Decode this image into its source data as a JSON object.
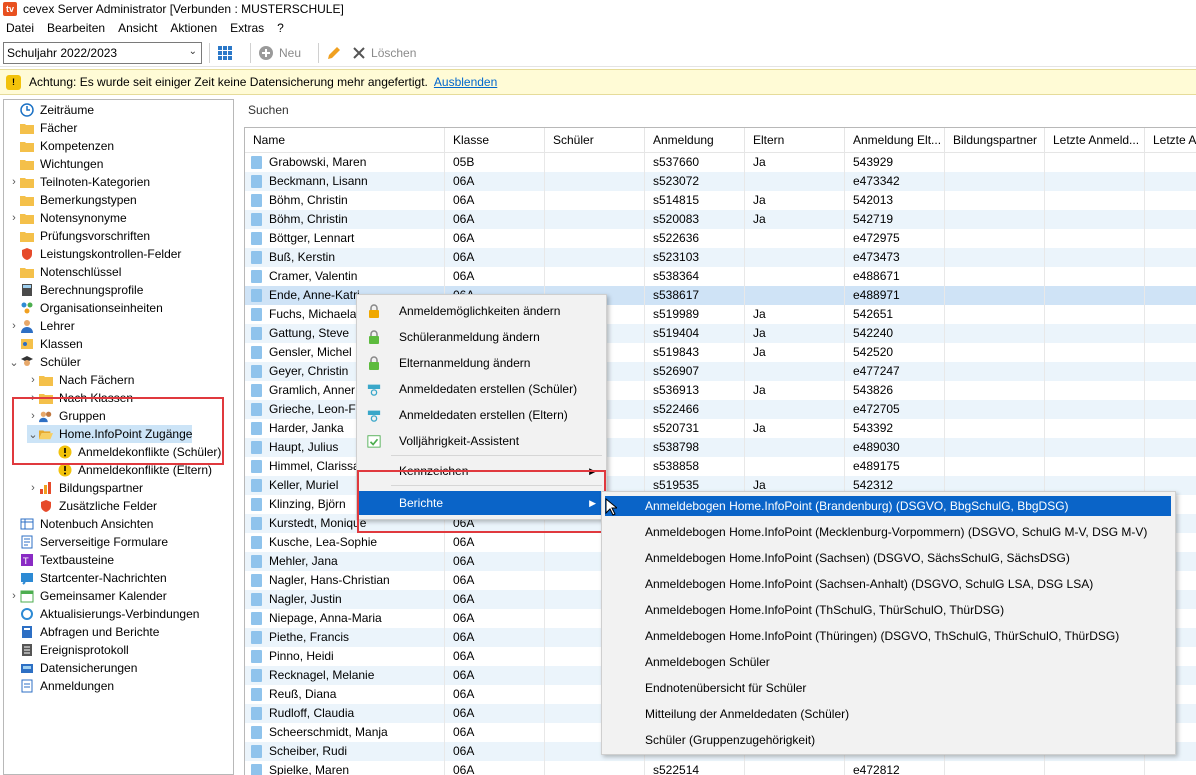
{
  "window": {
    "title": "cevex Server Administrator [Verbunden : MUSTERSCHULE]",
    "logo": "tv"
  },
  "menu": [
    "Datei",
    "Bearbeiten",
    "Ansicht",
    "Aktionen",
    "Extras",
    "?"
  ],
  "toolbar": {
    "school_year": "Schuljahr 2022/2023",
    "new_label": "Neu",
    "delete_label": "Löschen"
  },
  "warning": {
    "text": "Achtung: Es wurde seit einiger Zeit keine Datensicherung mehr angefertigt.",
    "link": "Ausblenden",
    "icon": "warning-icon"
  },
  "tree": [
    {
      "label": "Zeiträume",
      "icon": "clock-icon",
      "level": 0
    },
    {
      "label": "Fächer",
      "icon": "folder-icon",
      "level": 0
    },
    {
      "label": "Kompetenzen",
      "icon": "folder-icon",
      "level": 0
    },
    {
      "label": "Wichtungen",
      "icon": "folder-icon",
      "level": 0
    },
    {
      "label": "Teilnoten-Kategorien",
      "icon": "folder-icon",
      "level": 0,
      "exp": "›"
    },
    {
      "label": "Bemerkungstypen",
      "icon": "folder-icon",
      "level": 0
    },
    {
      "label": "Notensynonyme",
      "icon": "folder-icon",
      "level": 0,
      "exp": "›"
    },
    {
      "label": "Prüfungsvorschriften",
      "icon": "folder-icon",
      "level": 0
    },
    {
      "label": "Leistungskontrollen-Felder",
      "icon": "shield-icon",
      "level": 0
    },
    {
      "label": "Notenschlüssel",
      "icon": "folder-icon",
      "level": 0
    },
    {
      "label": "Berechnungsprofile",
      "icon": "calculator-icon",
      "level": 0
    },
    {
      "label": "Organisationseinheiten",
      "icon": "org-icon",
      "level": 0
    },
    {
      "label": "Lehrer",
      "icon": "person-icon",
      "level": 0,
      "exp": "›"
    },
    {
      "label": "Klassen",
      "icon": "class-icon",
      "level": 0
    },
    {
      "label": "Schüler",
      "icon": "student-icon",
      "level": 0,
      "exp": "⌄"
    },
    {
      "label": "Nach Fächern",
      "icon": "folder-icon",
      "level": 1,
      "exp": "›"
    },
    {
      "label": "Nach Klassen",
      "icon": "folder-icon",
      "level": 1,
      "exp": "›"
    },
    {
      "label": "Gruppen",
      "icon": "group-icon",
      "level": 1,
      "exp": "›"
    },
    {
      "label": "Home.InfoPoint Zugänge",
      "icon": "folder-open-icon",
      "level": 1,
      "exp": "⌄"
    },
    {
      "label": "Anmeldekonflikte (Schüler)",
      "icon": "warning-icon",
      "level": 2
    },
    {
      "label": "Anmeldekonflikte (Eltern)",
      "icon": "warning-icon",
      "level": 2
    },
    {
      "label": "Bildungspartner",
      "icon": "chart-icon",
      "level": 1,
      "exp": "›"
    },
    {
      "label": "Zusätzliche Felder",
      "icon": "shield-icon",
      "level": 1
    },
    {
      "label": "Notenbuch Ansichten",
      "icon": "table-icon",
      "level": 0
    },
    {
      "label": "Serverseitige Formulare",
      "icon": "form-icon",
      "level": 0
    },
    {
      "label": "Textbausteine",
      "icon": "text-icon",
      "level": 0
    },
    {
      "label": "Startcenter-Nachrichten",
      "icon": "message-icon",
      "level": 0
    },
    {
      "label": "Gemeinsamer Kalender",
      "icon": "calendar-icon",
      "level": 0,
      "exp": "›"
    },
    {
      "label": "Aktualisierungs-Verbindungen",
      "icon": "sync-icon",
      "level": 0
    },
    {
      "label": "Abfragen und Berichte",
      "icon": "report-icon",
      "level": 0
    },
    {
      "label": "Ereignisprotokoll",
      "icon": "log-icon",
      "level": 0
    },
    {
      "label": "Datensicherungen",
      "icon": "backup-icon",
      "level": 0
    },
    {
      "label": "Anmeldungen",
      "icon": "login-icon",
      "level": 0
    }
  ],
  "search_label": "Suchen",
  "columns": [
    "Name",
    "Klasse",
    "Schüler",
    "Anmeldung",
    "Eltern",
    "Anmeldung Elt...",
    "Bildungspartner",
    "Letzte Anmeld...",
    "Letzte A"
  ],
  "rows": [
    [
      "Grabowski, Maren",
      "05B",
      "",
      "s537660",
      "Ja",
      "543929"
    ],
    [
      "Beckmann, Lisann",
      "06A",
      "",
      "s523072",
      "",
      "e473342"
    ],
    [
      "Böhm, Christin",
      "06A",
      "",
      "s514815",
      "Ja",
      "542013"
    ],
    [
      "Böhm, Christin",
      "06A",
      "",
      "s520083",
      "Ja",
      "542719"
    ],
    [
      "Böttger, Lennart",
      "06A",
      "",
      "s522636",
      "",
      "e472975"
    ],
    [
      "Buß, Kerstin",
      "06A",
      "",
      "s523103",
      "",
      "e473473"
    ],
    [
      "Cramer, Valentin",
      "06A",
      "",
      "s538364",
      "",
      "e488671"
    ],
    [
      "Ende, Anne-Katri",
      "06A",
      "",
      "s538617",
      "",
      "e488971"
    ],
    [
      "Fuchs, Michaela",
      "",
      "",
      "s519989",
      "Ja",
      "542651"
    ],
    [
      "Gattung, Steve",
      "",
      "",
      "s519404",
      "Ja",
      "542240"
    ],
    [
      "Gensler, Michel",
      "",
      "",
      "s519843",
      "Ja",
      "542520"
    ],
    [
      "Geyer, Christin",
      "",
      "",
      "s526907",
      "",
      "e477247"
    ],
    [
      "Gramlich, Anner",
      "",
      "",
      "s536913",
      "Ja",
      "543826"
    ],
    [
      "Grieche, Leon-Fa",
      "",
      "",
      "s522466",
      "",
      "e472705"
    ],
    [
      "Harder, Janka",
      "",
      "",
      "s520731",
      "Ja",
      "543392"
    ],
    [
      "Haupt, Julius",
      "",
      "",
      "s538798",
      "",
      "e489030"
    ],
    [
      "Himmel, Clarissa",
      "",
      "",
      "s538858",
      "",
      "e489175"
    ],
    [
      "Keller, Muriel",
      "",
      "",
      "s519535",
      "Ja",
      "542312"
    ],
    [
      "Klinzing, Björn",
      "",
      "",
      "",
      "",
      ""
    ],
    [
      "Kurstedt, Monique",
      "06A",
      "",
      "",
      "",
      ""
    ],
    [
      "Kusche, Lea-Sophie",
      "06A",
      "",
      "",
      "",
      ""
    ],
    [
      "Mehler, Jana",
      "06A",
      "",
      "",
      "",
      ""
    ],
    [
      "Nagler, Hans-Christian",
      "06A",
      "",
      "",
      "",
      ""
    ],
    [
      "Nagler, Justin",
      "06A",
      "",
      "",
      "",
      ""
    ],
    [
      "Niepage, Anna-Maria",
      "06A",
      "",
      "",
      "",
      ""
    ],
    [
      "Piethe, Francis",
      "06A",
      "",
      "",
      "",
      ""
    ],
    [
      "Pinno, Heidi",
      "06A",
      "",
      "",
      "",
      ""
    ],
    [
      "Recknagel, Melanie",
      "06A",
      "",
      "",
      "",
      ""
    ],
    [
      "Reuß, Diana",
      "06A",
      "",
      "",
      "",
      ""
    ],
    [
      "Rudloff, Claudia",
      "06A",
      "",
      "",
      "",
      ""
    ],
    [
      "Scheerschmidt, Manja",
      "06A",
      "",
      "",
      "",
      ""
    ],
    [
      "Scheiber, Rudi",
      "06A",
      "",
      "",
      "",
      ""
    ],
    [
      "Spielke, Maren",
      "06A",
      "",
      "s522514",
      "",
      "e472812"
    ]
  ],
  "context_menu": [
    {
      "label": "Anmeldemöglichkeiten ändern",
      "icon": "lock-orange-icon"
    },
    {
      "label": "Schüleranmeldung ändern",
      "icon": "lock-green-icon"
    },
    {
      "label": "Elternanmeldung ändern",
      "icon": "lock-green-icon"
    },
    {
      "label": "Anmeldedaten erstellen (Schüler)",
      "icon": "credentials-icon"
    },
    {
      "label": "Anmeldedaten erstellen (Eltern)",
      "icon": "credentials-icon"
    },
    {
      "label": "Volljährigkeit-Assistent",
      "icon": "wizard-icon"
    },
    {
      "label": "Kennzeichen",
      "icon": "",
      "submenu": true
    },
    {
      "label": "Berichte",
      "icon": "",
      "submenu": true,
      "highlight": true
    }
  ],
  "reports_submenu": [
    "Anmeldebogen Home.InfoPoint (Brandenburg) (DSGVO, BbgSchulG, BbgDSG)",
    "Anmeldebogen Home.InfoPoint (Mecklenburg-Vorpommern) (DSGVO, SchulG M-V, DSG M-V)",
    "Anmeldebogen Home.InfoPoint (Sachsen) (DSGVO, SächsSchulG, SächsDSG)",
    "Anmeldebogen Home.InfoPoint (Sachsen-Anhalt) (DSGVO, SchulG LSA, DSG LSA)",
    "Anmeldebogen Home.InfoPoint (ThSchulG, ThürSchulO, ThürDSG)",
    "Anmeldebogen Home.InfoPoint (Thüringen) (DSGVO, ThSchulG, ThürSchulO, ThürDSG)",
    "Anmeldebogen Schüler",
    "Endnotenübersicht für Schüler",
    "Mitteilung der Anmeldedaten (Schüler)",
    "Schüler (Gruppenzugehörigkeit)"
  ],
  "colors": {
    "accent": "#0a64c8",
    "warning_bg": "#fffbd6",
    "highlight_box": "#e0393e",
    "row_alt": "#ebf4fb"
  }
}
